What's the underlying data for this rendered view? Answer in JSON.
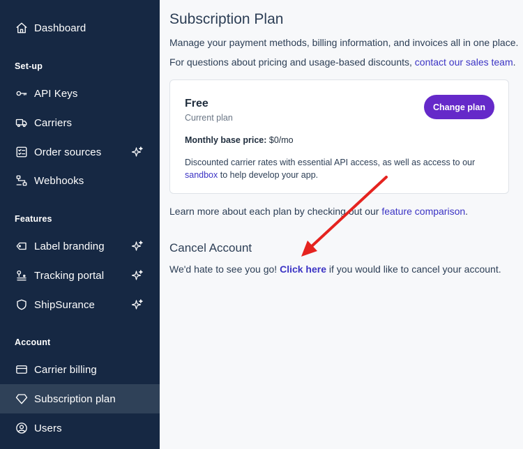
{
  "sidebar": {
    "items": [
      {
        "label": "Dashboard",
        "icon": "home-icon"
      },
      {
        "label": "API Keys",
        "icon": "key-icon"
      },
      {
        "label": "Carriers",
        "icon": "truck-icon"
      },
      {
        "label": "Order sources",
        "icon": "checklist-icon"
      },
      {
        "label": "Webhooks",
        "icon": "webhook-icon"
      },
      {
        "label": "Label branding",
        "icon": "label-icon"
      },
      {
        "label": "Tracking portal",
        "icon": "tracking-icon"
      },
      {
        "label": "ShipSurance",
        "icon": "shield-icon"
      },
      {
        "label": "Carrier billing",
        "icon": "credit-card-icon"
      },
      {
        "label": "Subscription plan",
        "icon": "diamond-icon"
      },
      {
        "label": "Users",
        "icon": "user-circle-icon"
      }
    ],
    "sections": {
      "setup": "Set-up",
      "features": "Features",
      "account": "Account"
    },
    "active_item": "Subscription plan"
  },
  "main": {
    "title": "Subscription Plan",
    "intro_line1": "Manage your payment methods, billing information, and invoices all in one place.",
    "intro_line2_prefix": "For questions about pricing and usage-based discounts, ",
    "intro_line2_link": "contact our sales team",
    "intro_line2_suffix": ".",
    "plan_card": {
      "name": "Free",
      "status": "Current plan",
      "price_label": "Monthly base price:",
      "price_value": "$0/mo",
      "description_prefix": "Discounted carrier rates with essential API access, as well as access to our ",
      "description_link": "sandbox",
      "description_suffix": " to help develop your app.",
      "change_button": "Change plan"
    },
    "compare_prefix": "Learn more about each plan by checking out our ",
    "compare_link": "feature comparison",
    "compare_suffix": ".",
    "cancel_title": "Cancel Account",
    "cancel_prefix": "We'd hate to see you go! ",
    "cancel_link": "Click here",
    "cancel_suffix": " if you would like to cancel your account."
  },
  "colors": {
    "sidebar_bg": "#162843",
    "active_bg": "#2f4158",
    "accent": "#6529c9",
    "link": "#3b33c4",
    "annotation_arrow": "#e5231f"
  }
}
